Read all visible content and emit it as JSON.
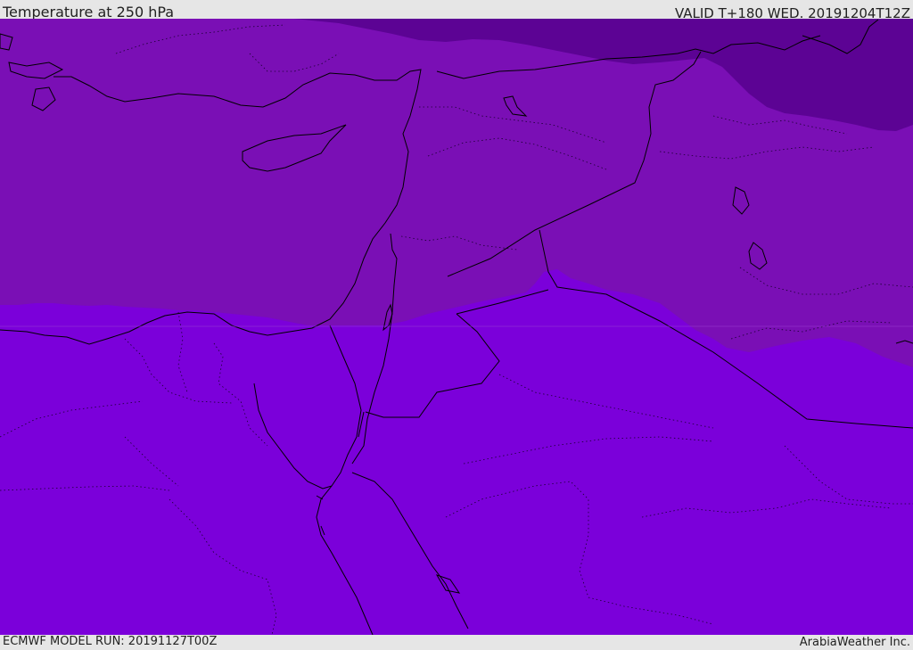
{
  "header": {
    "title": "Temperature at 250 hPa",
    "valid_time": "VALID T+180 WED. 20191204T12Z"
  },
  "footer": {
    "model_run": "ECMWF MODEL RUN: 20191127T00Z",
    "credit": "ArabiaWeather Inc."
  },
  "map": {
    "field_colors": {
      "coldest_band": "#5c0394",
      "cold_band": "#7a0fb5",
      "warm_band": "#7b00da"
    },
    "coastline_color": "#000000",
    "border_style": "dotted"
  }
}
